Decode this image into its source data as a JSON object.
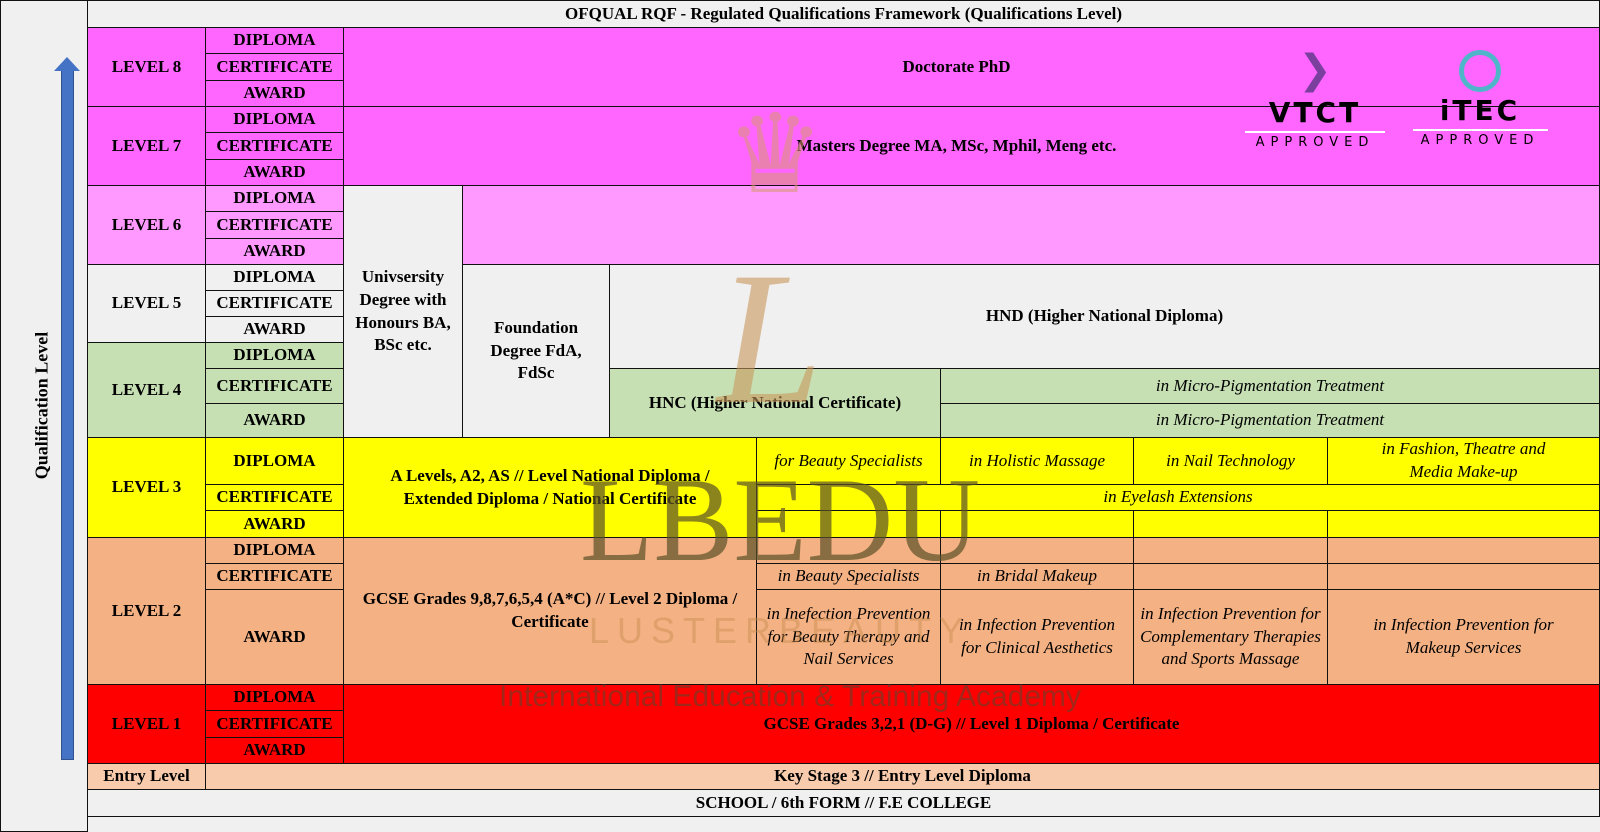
{
  "title": "OFQUAL RQF - Regulated Qualifications Framework (Qualifications Level)",
  "axis_label": "Qualification Level",
  "types": [
    "DIPLOMA",
    "CERTIFICATE",
    "AWARD"
  ],
  "levels": {
    "l8": "LEVEL 8",
    "l7": "LEVEL 7",
    "l6": "LEVEL 6",
    "l5": "LEVEL 5",
    "l4": "LEVEL 4",
    "l3": "LEVEL 3",
    "l2": "LEVEL 2",
    "l1": "LEVEL 1",
    "entry": "Entry Level"
  },
  "content": {
    "doctorate": "Doctorate PhD",
    "masters": "Masters Degree MA, MSc, Mphil, Meng etc.",
    "university": "Univsersity Degree with Honours BA, BSc etc.",
    "foundation": "Foundation Degree FdA, FdSc",
    "hnd": "HND (Higher National Diploma)",
    "hnc": "HNC (Higher National Certificate)",
    "micro1": "in Micro-Pigmentation Treatment",
    "micro2": "in Micro-Pigmentation Treatment",
    "alevels": "A Levels, A2, AS // Level National Diploma / Extended Diploma / National Certificate",
    "l3_beauty": "for Beauty Specialists",
    "l3_holistic": "in Holistic Massage",
    "l3_nail": "in Nail Technology",
    "l3_fashion": "in Fashion, Theatre and Media Make-up",
    "l3_eyelash": "in Eyelash Extensions",
    "gcse": "GCSE Grades 9,8,7,6,5,4 (A*C) // Level 2 Diploma / Certificate",
    "l2_beauty": "in Beauty Specialists",
    "l2_bridal": "in Bridal Makeup",
    "l2_inf1": "in Inefection Prevention for Beauty Therapy and Nail Services",
    "l2_inf2": "in Infection Prevention for Clinical Aesthetics",
    "l2_inf3": "in Infection Prevention for Complementary Therapies and Sports Massage",
    "l2_inf4": "in Infection Prevention for Makeup Services",
    "l1": "GCSE Grades 3,2,1 (D-G) // Level 1 Diploma / Certificate",
    "entry": "Key Stage 3 // Entry Level Diploma",
    "school": "SCHOOL / 6th FORM // F.E COLLEGE"
  },
  "logos": {
    "vtct": "VTCT",
    "itec": "iTEC",
    "approved": "APPROVED"
  },
  "watermark": {
    "brand": "LBEDU",
    "sub": "LUSTERBEAUTY",
    "tagline": "International Education & Training Academy",
    "letter": "L"
  },
  "colors": {
    "level8": "#ff66ff",
    "level6": "#ff99ff",
    "level4": "#c6e0b4",
    "level3": "#ffff00",
    "level2": "#f4b183",
    "level1": "#ff0000",
    "entry": "#f8cbad",
    "arrow": "#4472c4"
  }
}
